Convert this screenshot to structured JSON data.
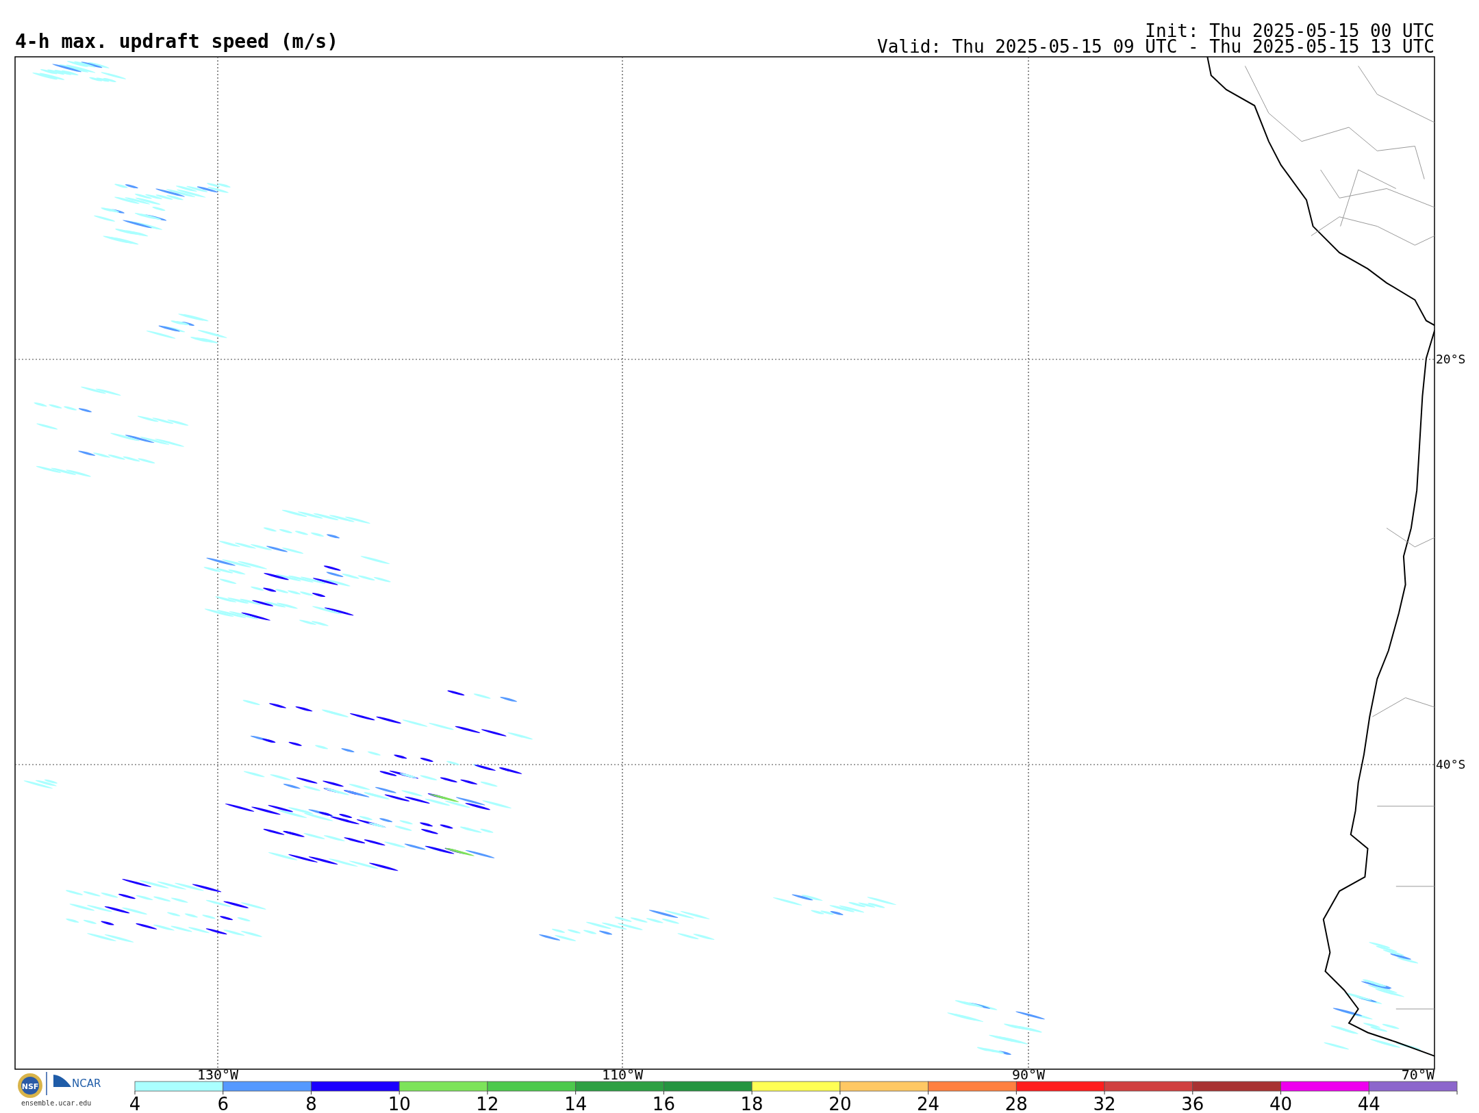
{
  "title": "4-h max. updraft speed (m/s)",
  "init": "Init: Thu 2025-05-15 00 UTC",
  "valid": "Valid: Thu 2025-05-15 09 UTC - Thu 2025-05-15 13 UTC",
  "lat_labels": [
    "20°S",
    "40°S"
  ],
  "lon_labels": [
    "130°W",
    "110°W",
    "90°W",
    "70°W"
  ],
  "colorbar": {
    "segments": [
      {
        "color": "#aaffff"
      },
      {
        "color": "#5599ff"
      },
      {
        "color": "#1a00ff"
      },
      {
        "color": "#7de35a"
      },
      {
        "color": "#4dc94d"
      },
      {
        "color": "#2ea043"
      },
      {
        "color": "#259440"
      },
      {
        "color": "#ffff55"
      },
      {
        "color": "#ffc864"
      },
      {
        "color": "#ff8040"
      },
      {
        "color": "#ff1e1e"
      },
      {
        "color": "#d04040"
      },
      {
        "color": "#a83232"
      },
      {
        "color": "#ee00ee"
      },
      {
        "color": "#8c66cc"
      }
    ],
    "ticks": [
      "4",
      "6",
      "8",
      "10",
      "12",
      "14",
      "16",
      "18",
      "20",
      "24",
      "28",
      "32",
      "36",
      "40",
      "44"
    ]
  },
  "logos": {
    "nsf": "NSF",
    "ncar": "NCAR"
  },
  "site": "ensemble.ucar.edu"
}
